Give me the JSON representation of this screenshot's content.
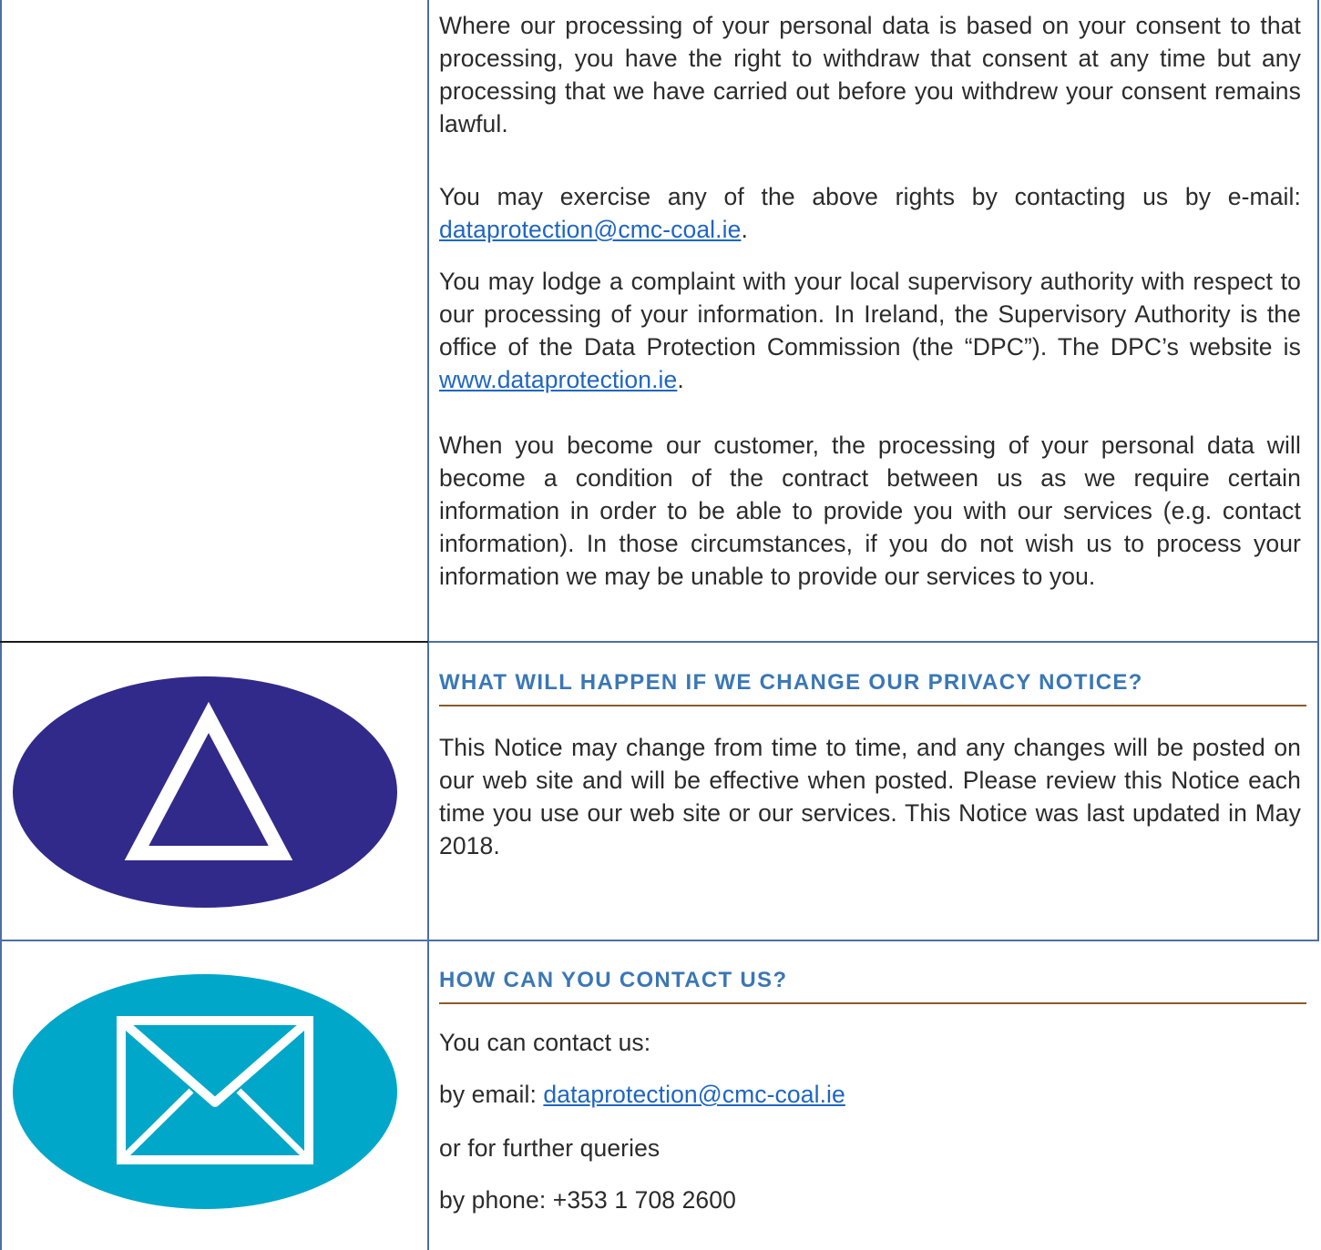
{
  "consent": {
    "para1": "Where our processing of your personal data is based on your consent to that processing, you have the right to withdraw that consent at any time but any processing that we have carried out before you withdrew your consent remains lawful.",
    "para2_prefix": "You may exercise any of the above rights by contacting us by e-mail: ",
    "para2_email": "dataprotection@cmc-coal.ie",
    "para2_suffix": ".",
    "para3_prefix": "You may lodge a complaint with your local supervisory authority with respect to our processing of your information. In Ireland, the Supervisory Authority is the office of the Data Protection Commission (the “DPC”). The DPC’s website is ",
    "para3_link": "www.dataprotection.ie",
    "para3_suffix": ".",
    "para4": "When you become our customer, the processing of your personal data will become a condition of the contract between us as we require certain information in order to be able to provide you with our services (e.g. contact information). In those circumstances, if you do not wish us to process your information we may be unable to provide our services to you."
  },
  "change_section": {
    "icon": "warning-triangle-icon",
    "icon_color": "#312a8a",
    "heading": "WHAT WILL HAPPEN IF WE CHANGE OUR PRIVACY NOTICE?",
    "body": "This Notice may change from time to time, and any changes will be posted on our web site and will be effective when posted. Please review this Notice each time you use our web site or our services. This Notice was last updated in May 2018."
  },
  "contact_section": {
    "icon": "envelope-icon",
    "icon_color": "#00a7c9",
    "heading": "HOW CAN YOU CONTACT US?",
    "intro": "You can contact us:",
    "email_prefix": "by email: ",
    "email": "dataprotection@cmc-coal.ie",
    "further": "or for further queries",
    "phone": "by phone: +353 1 708 2600"
  }
}
